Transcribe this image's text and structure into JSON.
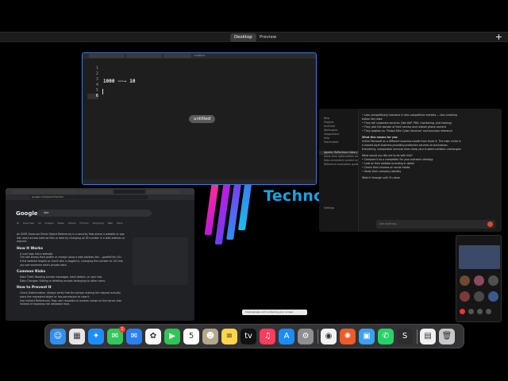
{
  "spaces": {
    "tabs": [
      {
        "label": "Desktop"
      },
      {
        "label": "Preview"
      }
    ],
    "add_label": "+"
  },
  "wallpaper": {
    "logo_text": "Techno",
    "colors": [
      "#e6177f",
      "#a41de0",
      "#6a4ff0",
      "#1fb0f0"
    ]
  },
  "editor": {
    "title": "untitled",
    "line_numbers": [
      "1",
      "2",
      "3",
      "4",
      "5",
      "6"
    ],
    "active_line": "6",
    "line_left": "1000",
    "arrow": "——→",
    "line_right": "10",
    "window_label": "untitled"
  },
  "chat": {
    "sidebar_items": [
      "New",
      "Projects",
      "Archived",
      "Workspace",
      "Integrations",
      "Help",
      "Teammates",
      "Agentic Reflections history",
      "Short-term optimization profile",
      "Data-consistent content enhancement",
      "Reference evaluation guide",
      "Settings"
    ],
    "lines": [
      "• Less competitively-intensive in less competitive markets — less tumbling",
      "  tuition fee rates",
      "• They sell corporate services (like VoIP, PBX, monitoring, and hosting)",
      "• They pick the domain of their service and related phone content",
      "• They position as \"Global Elite Cyber Services\" and business reference",
      "What this means for you:",
      "Unlike Microsoft as a different business model from Excel it, The main niche is",
      "a shared-style business providing protection services to businesses.",
      "Everything, comparable services even keep your trusted numbers unchanged.",
      "What would you like me to do with this?",
      "• Compare it as a competitor for your outreach strategy",
      "• Look at their website branding in detail",
      "• Check their reviews on social media",
      "• Verify their company identity",
      "Write it through until it's done"
    ],
    "input_placeholder": "Ask anything..."
  },
  "browser": {
    "url": "google.com/search?q=idor",
    "logo": "Google",
    "query": "idor",
    "search_tabs": "AI Overview  All  Images  News  Videos  Forums  Shopping  Web  More",
    "intro": "An IDOR (Insecure Direct Object Reference) is a security flaw where a website or app lets users access internal files or data by changing an ID number in a web address or request.",
    "sections": [
      {
        "heading": "How It Works",
        "items": [
          "A user logs into a website.",
          "The site shows their profile or receipt using a web address like .../profile?id=101",
          "If the website forgets to check who is logged in, changing the number to 102 lets you see someone else's private data."
        ]
      },
      {
        "heading": "Common Risks",
        "items": [
          "Data Theft: Reading private messages, bank details, or user info.",
          "Data Changes: Editing or deleting records belonging to other users."
        ]
      },
      {
        "heading": "How to Prevent It",
        "items": [
          "Check Authorization: Always verify that the person making the request actually owns the requested object or has permission to view it.",
          "Use Indirect References: Map user requests to random values on the server side instead of exposing real database keys."
        ]
      }
    ]
  },
  "notice": {
    "text": "meet.google.com is sharing your screen"
  },
  "dock": {
    "apps": [
      {
        "name": "finder-icon",
        "color": "#2f8ff0",
        "glyph": "☺"
      },
      {
        "name": "launchpad-icon",
        "color": "#e5e5ea",
        "glyph": "▦"
      },
      {
        "name": "safari-icon",
        "color": "#1c8ef9",
        "glyph": "✦"
      },
      {
        "name": "messages-icon",
        "color": "#34c759",
        "glyph": "✉",
        "badge": "1"
      },
      {
        "name": "mail-icon",
        "color": "#2a7ff3",
        "glyph": "✉"
      },
      {
        "name": "photos-icon",
        "color": "#f7f7f7",
        "glyph": "✿"
      },
      {
        "name": "facetime-icon",
        "color": "#30c653",
        "glyph": "▶"
      },
      {
        "name": "calendar-icon",
        "color": "#ffffff",
        "glyph": "5"
      },
      {
        "name": "contacts-icon",
        "color": "#b6a78c",
        "glyph": "☻"
      },
      {
        "name": "notes-icon",
        "color": "#ffd54a",
        "glyph": "≡"
      },
      {
        "name": "apple-tv-icon",
        "color": "#111111",
        "glyph": "tv"
      },
      {
        "name": "music-icon",
        "color": "#fb3c5a",
        "glyph": "♫"
      },
      {
        "name": "app-store-icon",
        "color": "#1a8cf6",
        "glyph": "A"
      },
      {
        "name": "system-settings-icon",
        "color": "#8e8e93",
        "glyph": "⚙"
      },
      {
        "name": "chrome-icon",
        "color": "#f1f1f1",
        "glyph": "◉"
      },
      {
        "name": "pinwheel-app-icon",
        "color": "#f05a28",
        "glyph": "✺"
      },
      {
        "name": "preview-icon",
        "color": "#3aa0f0",
        "glyph": "▣"
      },
      {
        "name": "whatsapp-icon",
        "color": "#25d366",
        "glyph": "✆"
      },
      {
        "name": "sublime-text-icon",
        "color": "#2d2d2d",
        "glyph": "S"
      },
      {
        "name": "document-icon",
        "color": "#f0f0f0",
        "glyph": "▤"
      },
      {
        "name": "trash-icon",
        "color": "#c8c8cc",
        "glyph": "🗑"
      }
    ]
  }
}
